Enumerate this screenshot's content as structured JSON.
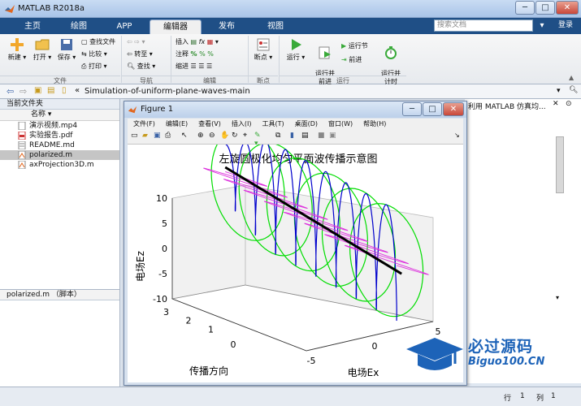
{
  "app": {
    "title": "MATLAB R2018a"
  },
  "tabs": [
    {
      "label": "主页"
    },
    {
      "label": "绘图"
    },
    {
      "label": "APP"
    },
    {
      "label": "编辑器"
    },
    {
      "label": "发布"
    },
    {
      "label": "视图"
    }
  ],
  "search": {
    "placeholder": "搜索文档",
    "login": "登录"
  },
  "ribbon": {
    "new": "新建",
    "open": "打开",
    "save": "保存",
    "find_files": "查找文件",
    "compare": "比较",
    "print": "打印",
    "goto": "转至",
    "find": "查找",
    "insert": "插入",
    "comment": "注释",
    "indent": "缩进",
    "breakpoint": "断点",
    "run": "运行",
    "run_advance": "运行并\n前进",
    "run_section": "运行节",
    "advance": "前进",
    "run_time": "运行并\n计时",
    "groups": [
      "文件",
      "导航",
      "编辑",
      "断点",
      "运行"
    ]
  },
  "address": {
    "path": "Simulation-of-uniform-plane-waves-main"
  },
  "filepanel": {
    "title": "当前文件夹",
    "column": "名称",
    "files": [
      "演示视频.mp4",
      "实验报告.pdf",
      "README.md",
      "polarized.m",
      "axProjection3D.m"
    ],
    "selected_index": 3
  },
  "detail": {
    "label": "polarized.m （脚本）"
  },
  "rightpanel": {
    "title": "利用 MATLAB 仿真均..."
  },
  "figure": {
    "title": "Figure 1",
    "menu": [
      "文件(F)",
      "编辑(E)",
      "查看(V)",
      "插入(I)",
      "工具(T)",
      "桌面(D)",
      "窗口(W)",
      "帮助(H)"
    ]
  },
  "chart_data": {
    "type": "line",
    "title": "左旋圆极化均匀平面波传播示意图",
    "zlabel": "电场Ez",
    "xlabel": "电场Ex",
    "ylabel": "传播方向",
    "zticks": [
      10,
      5,
      0,
      -5,
      -10
    ],
    "yticks": [
      3,
      2,
      1,
      0
    ],
    "xticks": [
      -5,
      0,
      5
    ],
    "series": [
      {
        "color": "#00dd00"
      },
      {
        "color": "#0000cc"
      },
      {
        "color": "#dd33dd"
      },
      {
        "color": "#000000"
      }
    ]
  },
  "watermark": {
    "text1": "必过源码",
    "text2": "Biguo100.CN"
  },
  "status": {
    "row_label": "行",
    "row": "1",
    "col_label": "列",
    "col": "1"
  }
}
